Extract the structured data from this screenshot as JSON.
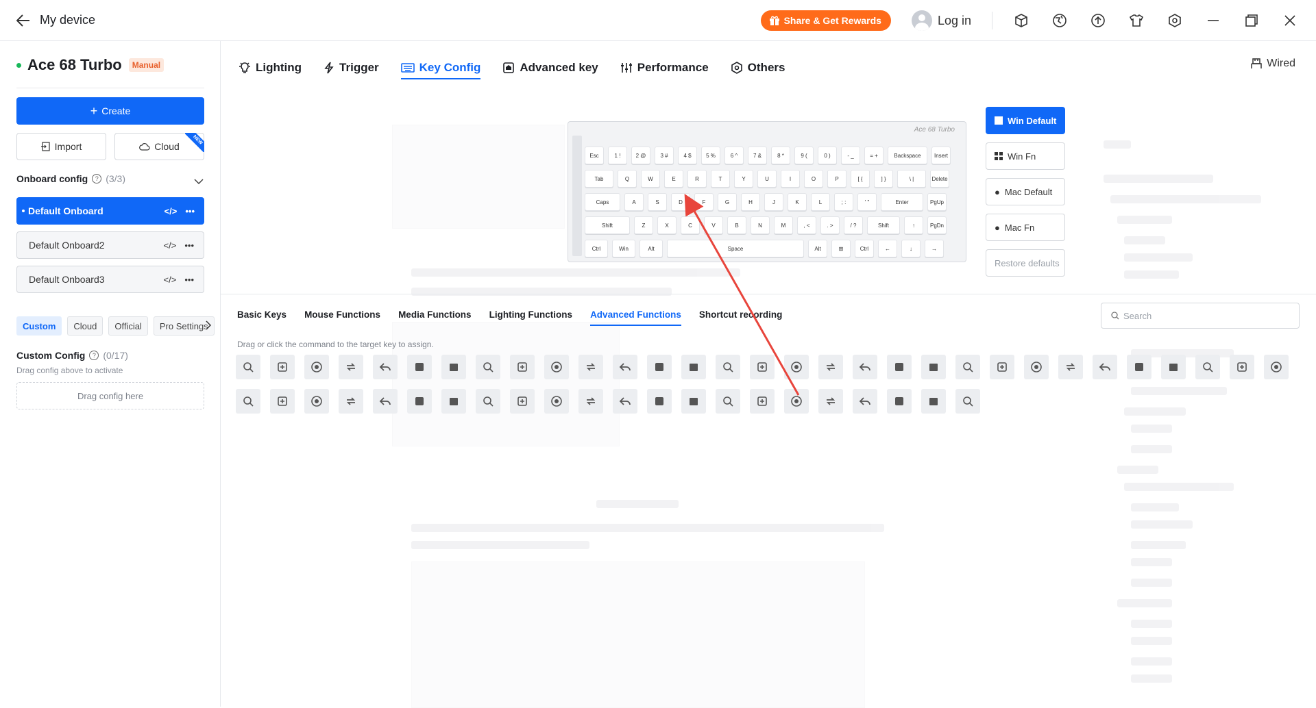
{
  "titlebar": {
    "title": "My device",
    "share_label": "Share & Get Rewards",
    "login_label": "Log in"
  },
  "sidebar": {
    "device_name": "Ace 68 Turbo",
    "mode_badge": "Manual",
    "create_label": "Create",
    "import_label": "Import",
    "cloud_label": "Cloud",
    "new_badge": "NEW",
    "onboard_title": "Onboard config",
    "onboard_count": "(3/3)",
    "onboard_items": [
      "Default Onboard",
      "Default Onboard2",
      "Default Onboard3"
    ],
    "config_tabs": [
      "Custom",
      "Cloud",
      "Official",
      "Pro Settings"
    ],
    "custom_title": "Custom Config",
    "custom_count": "(0/17)",
    "custom_sub": "Drag config above to activate",
    "dropzone": "Drag config here"
  },
  "main": {
    "tabs": [
      "Lighting",
      "Trigger",
      "Key Config",
      "Advanced key",
      "Performance",
      "Others"
    ],
    "active_tab": "Key Config",
    "connection": "Wired",
    "keyboard_title": "Ace 68 Turbo",
    "layout_buttons": [
      "Win Default",
      "Win Fn",
      "Mac Default",
      "Mac Fn",
      "Restore defaults"
    ],
    "function_tabs": [
      "Basic Keys",
      "Mouse Functions",
      "Media Functions",
      "Lighting Functions",
      "Advanced Functions",
      "Shortcut recording"
    ],
    "active_function_tab": "Advanced Functions",
    "search_placeholder": "Search",
    "hint": "Drag or click the command to the target key to assign."
  },
  "keyboard_rows": [
    [
      "Esc",
      "1 !",
      "2 @",
      "3 #",
      "4 $",
      "5 %",
      "6 ^",
      "7 &",
      "8 *",
      "9 (",
      "0 )",
      "- _",
      "= +",
      "Backspace",
      "Insert"
    ],
    [
      "Tab",
      "Q",
      "W",
      "E",
      "R",
      "T",
      "Y",
      "U",
      "I",
      "O",
      "P",
      "[ {",
      "] }",
      "\\ |",
      "Delete"
    ],
    [
      "Caps",
      "A",
      "S",
      "D",
      "F",
      "G",
      "H",
      "J",
      "K",
      "L",
      "; :",
      "' \"",
      "Enter",
      "PgUp"
    ],
    [
      "Shift",
      "Z",
      "X",
      "C",
      "V",
      "B",
      "N",
      "M",
      ", <",
      ". >",
      "/ ?",
      "Shift",
      "↑",
      "PgDn"
    ],
    [
      "Ctrl",
      "Win",
      "Alt",
      "Space",
      "Alt",
      "⊞",
      "Ctrl",
      "←",
      "↓",
      "→"
    ]
  ],
  "function_icons_row1": [
    "zoom-out-icon",
    "zoom-in-icon",
    "record-icon",
    "refresh-icon",
    "undo-icon",
    "checkbox-icon",
    "folder-add-icon",
    "document-icon",
    "cut-icon",
    "pie-icon",
    "save-icon",
    "open-folder-icon",
    "add-window-icon",
    "close-window-icon",
    "back-icon",
    "forward-icon",
    "calendar-icon",
    "monitor-icon",
    "book-icon",
    "sync-icon",
    "cube-icon",
    "columns-icon",
    "presentation-icon",
    "lock-icon",
    "badge-icon",
    "form-icon",
    "xbox-icon",
    "chart-icon",
    "search-icon",
    "settings-icon",
    "grid-icon"
  ],
  "function_icons_row2": [
    "emoji-icon",
    "menu-icon",
    "dock-icon",
    "minimize-icon",
    "switch-icon",
    "browser-icon",
    "app-grid-icon",
    "mail-icon",
    "window-icon",
    "upload-icon",
    "shield-icon",
    "list-icon",
    "brightness-low-icon",
    "brightness-high-icon",
    "magnifier-icon",
    "swap-icon",
    "chip-icon",
    "disable-icon",
    "windows-icon",
    "windows-fn-icon",
    "apple-icon",
    "apple-fn-icon"
  ],
  "colors": {
    "accent": "#1068f7",
    "share": "#ff6b1a",
    "manual": "#e8602c",
    "online": "#19b85a"
  }
}
